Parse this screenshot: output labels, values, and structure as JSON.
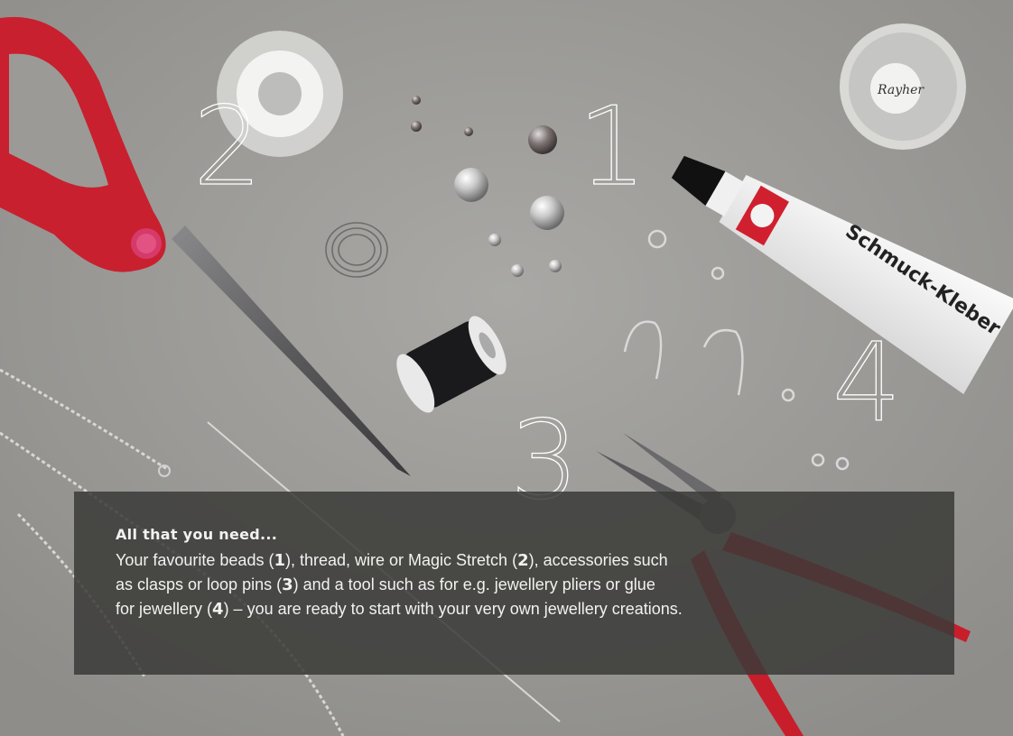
{
  "numbers": {
    "n1": "1",
    "n2": "2",
    "n3": "3",
    "n4": "4"
  },
  "tube_label": {
    "brand": "Rayher",
    "text": "Schmuck-Kleber"
  },
  "box_label": "Rayher",
  "caption": {
    "heading": "All that you need...",
    "line1_a": "Your favourite beads (",
    "line1_n1": "1",
    "line1_b": "), thread, wire or Magic Stretch (",
    "line1_n2": "2",
    "line1_c": "), accessories such",
    "line2_a": "as clasps or loop pins (",
    "line2_n3": "3",
    "line2_b": ") and a tool such as for e.g. jewellery pliers or glue",
    "line3_a": "for jewellery (",
    "line3_n4": "4",
    "line3_b": ") – you are ready to start with your very own jewellery creations."
  },
  "colors": {
    "background": "#9b9a97",
    "scissors": "#c8202f",
    "pliers": "#c81e2b",
    "overlay": "#3a3a38"
  }
}
